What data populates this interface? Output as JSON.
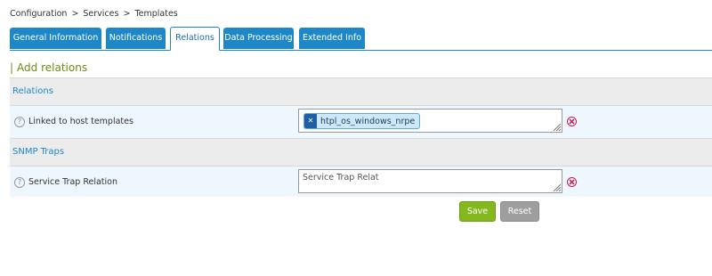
{
  "breadcrumb": {
    "items": [
      "Configuration",
      "Services",
      "Templates"
    ],
    "separator": ">"
  },
  "tabs": [
    {
      "label": "General Information"
    },
    {
      "label": "Notifications"
    },
    {
      "label": "Relations",
      "active": true
    },
    {
      "label": "Data Processing"
    },
    {
      "label": "Extended Info"
    }
  ],
  "section": {
    "title": "Add relations"
  },
  "groups": {
    "relations": {
      "title": "Relations",
      "field": {
        "label": "Linked to host templates",
        "tags": [
          "htpl_os_windows_nrpe"
        ]
      }
    },
    "snmp": {
      "title": "SNMP Traps",
      "field": {
        "label": "Service Trap Relation",
        "placeholder": "Service Trap Relat"
      }
    }
  },
  "buttons": {
    "save": "Save",
    "reset": "Reset"
  },
  "colors": {
    "accent": "#1e87c8",
    "section_title": "#6c8a14",
    "save": "#84b81e",
    "reset": "#9e9e9e",
    "clear": "#d3174f"
  }
}
